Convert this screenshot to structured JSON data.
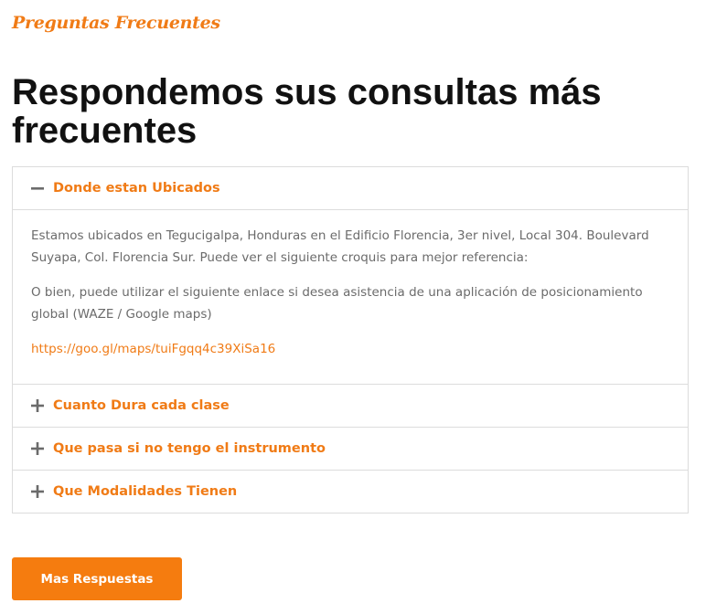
{
  "section": {
    "eyebrow": "Preguntas Frecuentes",
    "headline": "Respondemos sus consultas más frecuentes"
  },
  "faq": {
    "items": [
      {
        "question": "Donde estan Ubicados",
        "expanded": true,
        "icon": "minus-icon",
        "paragraphs": [
          "Estamos ubicados en Tegucigalpa, Honduras en el Edificio Florencia, 3er nivel, Local 304. Boulevard Suyapa, Col. Florencia Sur. Puede ver el siguiente croquis para mejor referencia:",
          "O bien, puede utilizar el siguiente enlace si desea asistencia de una aplicación de posicionamiento global (WAZE / Google maps)"
        ],
        "link": "https://goo.gl/maps/tuiFgqq4c39XiSa16"
      },
      {
        "question": "Cuanto Dura cada clase",
        "expanded": false,
        "icon": "plus-icon"
      },
      {
        "question": "Que pasa si no tengo el instrumento",
        "expanded": false,
        "icon": "plus-icon"
      },
      {
        "question": "Que Modalidades Tienen",
        "expanded": false,
        "icon": "plus-icon"
      }
    ]
  },
  "cta": {
    "label": "Mas Respuestas"
  },
  "colors": {
    "accent": "#f07b16",
    "button": "#f57c0f",
    "heading": "#111111",
    "body_text": "#6b6b6b",
    "icon": "#6b6b6b",
    "border": "#dcdcdc"
  }
}
